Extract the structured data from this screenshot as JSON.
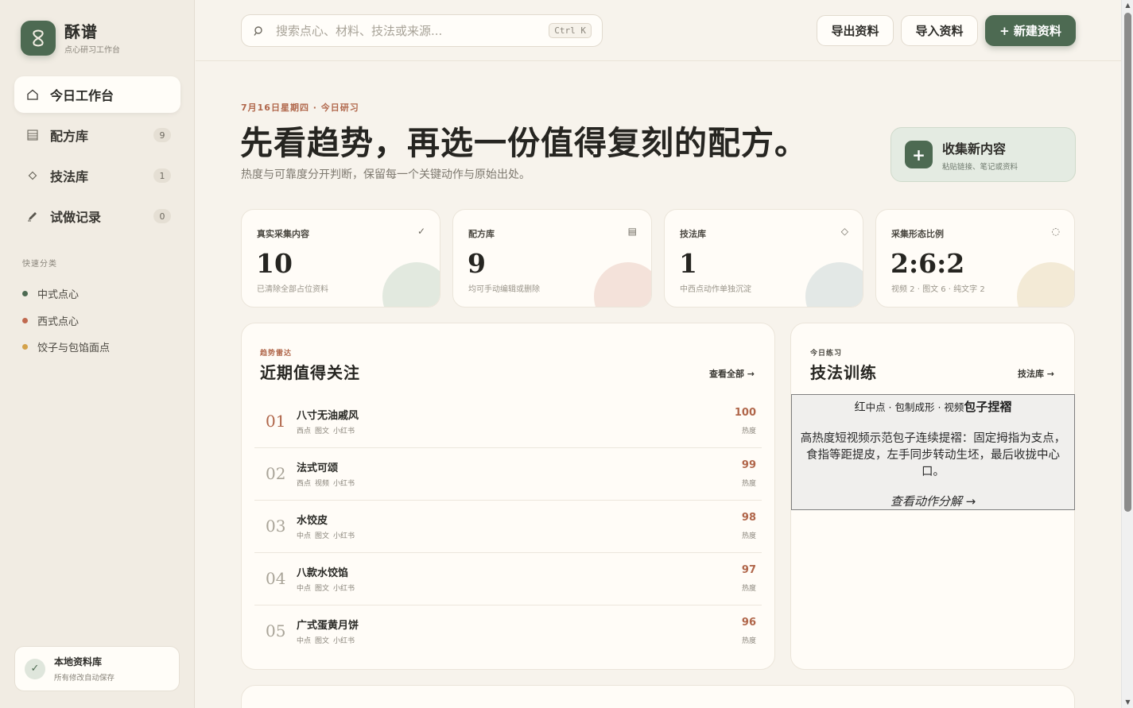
{
  "sidebar": {
    "brand_name": "酥谱",
    "brand_sub": "点心研习工作台",
    "nav": [
      {
        "label": "今日工作台",
        "icon": "home-icon",
        "badge": ""
      },
      {
        "label": "配方库",
        "icon": "list-icon",
        "badge": "9"
      },
      {
        "label": "技法库",
        "icon": "diamond-icon",
        "badge": "1"
      },
      {
        "label": "试做记录",
        "icon": "pencil-icon",
        "badge": "0"
      }
    ],
    "quick_title": "快速分类",
    "quick": [
      {
        "label": "中式点心",
        "color": "#4d6a52"
      },
      {
        "label": "西式点心",
        "color": "#c0694f"
      },
      {
        "label": "饺子与包馅面点",
        "color": "#d4a24a"
      }
    ],
    "local": {
      "title": "本地资料库",
      "sub": "所有修改自动保存",
      "icon": "check-icon"
    }
  },
  "topbar": {
    "search_placeholder": "搜索点心、材料、技法或来源...",
    "shortcut": "Ctrl K",
    "export_label": "导出资料",
    "import_label": "导入资料",
    "new_label": "+ 新建资料"
  },
  "hero": {
    "eyebrow": "7月16日星期四 · 今日研习",
    "title": "先看趋势，再选一份值得复刻的配方。",
    "sub": "热度与可靠度分开判断，保留每一个关键动作与原始出处。",
    "collect_title": "收集新内容",
    "collect_sub": "粘贴链接、笔记或资料"
  },
  "stats": [
    {
      "label": "真实采集内容",
      "icon": "✓",
      "value": "10",
      "note": "已清除全部占位资料",
      "blob": "#e2e9df"
    },
    {
      "label": "配方库",
      "icon": "▤",
      "value": "9",
      "note": "均可手动编辑或删除",
      "blob": "#f4e2da"
    },
    {
      "label": "技法库",
      "icon": "◇",
      "value": "1",
      "note": "中西点动作单独沉淀",
      "blob": "#e3e8e6"
    },
    {
      "label": "采集形态比例",
      "icon": "◌",
      "value": "2:6:2",
      "note": "视频 2 · 图文 6 · 纯文字 2",
      "blob": "#f3ead6"
    }
  ],
  "trends": {
    "eyebrow": "趋势雷达",
    "title": "近期值得关注",
    "link": "查看全部 →",
    "score_label": "热度",
    "items": [
      {
        "rank": "01",
        "name": "八寸无油戚风",
        "tags": [
          "西点",
          "图文",
          "小红书"
        ],
        "score": "100"
      },
      {
        "rank": "02",
        "name": "法式可颂",
        "tags": [
          "西点",
          "视频",
          "小红书"
        ],
        "score": "99"
      },
      {
        "rank": "03",
        "name": "水饺皮",
        "tags": [
          "中点",
          "图文",
          "小红书"
        ],
        "score": "98"
      },
      {
        "rank": "04",
        "name": "八款水饺馅",
        "tags": [
          "中点",
          "图文",
          "小红书"
        ],
        "score": "97"
      },
      {
        "rank": "05",
        "name": "广式蛋黄月饼",
        "tags": [
          "中点",
          "图文",
          "小红书"
        ],
        "score": "96"
      }
    ]
  },
  "training": {
    "eyebrow": "今日练习",
    "title": "技法训练",
    "link": "技法库 →",
    "head_prefix": "红",
    "head_meta": "中点 · 包制成形 · 视频",
    "head_name": "包子捏褶",
    "desc": "高热度短视频示范包子连续提褶：固定拇指为支点，食指等距提皮，左手同步转动生坯，最后收拢中心口。",
    "action": "查看动作分解 →"
  }
}
